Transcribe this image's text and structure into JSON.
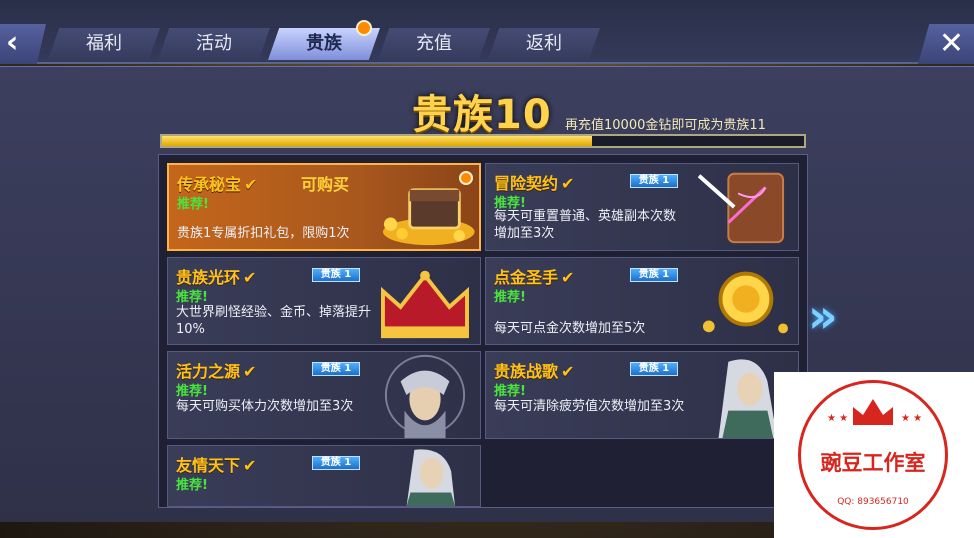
{
  "nav": {
    "back_icon": "chevron-left-icon",
    "close_icon": "close-icon",
    "tabs": [
      {
        "label": "福利"
      },
      {
        "label": "活动"
      },
      {
        "label": "贵族",
        "active": true
      },
      {
        "label": "充值"
      },
      {
        "label": "返利"
      }
    ]
  },
  "header": {
    "title": "贵族10",
    "subtitle": "再充值10000金钻即可成为贵族11",
    "progress": 0.67
  },
  "cards": [
    {
      "title": "传承秘宝",
      "status": "可购买",
      "recommend": "推荐!",
      "desc": "贵族1专属折扣礼包，限购1次",
      "badge": ""
    },
    {
      "title": "冒险契约",
      "status": "",
      "recommend": "推荐!",
      "desc": "每天可重置普通、英雄副本次数增加至3次",
      "badge": "贵族 1"
    },
    {
      "title": "贵族光环",
      "status": "",
      "recommend": "推荐!",
      "desc": "大世界刷怪经验、金币、掉落提升10%",
      "badge": "贵族 1"
    },
    {
      "title": "点金圣手",
      "status": "",
      "recommend": "推荐!",
      "desc": "每天可点金次数增加至5次",
      "badge": "贵族 1"
    },
    {
      "title": "活力之源",
      "status": "",
      "recommend": "推荐!",
      "desc": "每天可购买体力次数增加至3次",
      "badge": "贵族 1"
    },
    {
      "title": "贵族战歌",
      "status": "",
      "recommend": "推荐!",
      "desc": "每天可清除疲劳值次数增加至3次",
      "badge": "贵族 1"
    },
    {
      "title": "友情天下",
      "status": "",
      "recommend": "推荐!",
      "desc": "",
      "badge": "贵族 1"
    }
  ],
  "watermark": {
    "name": "豌豆工作室",
    "qq": "QQ: 893656710"
  },
  "colors": {
    "accent": "#ffc21a",
    "recommend": "#49e43d",
    "highlight": "#c4661b"
  }
}
